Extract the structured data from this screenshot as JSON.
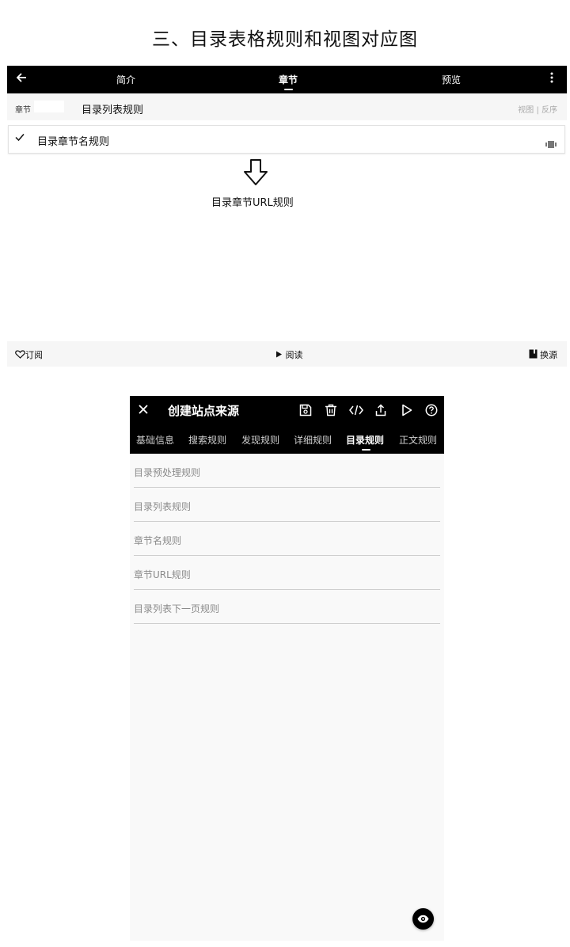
{
  "page_title": "三、目录表格规则和视图对应图",
  "panel1": {
    "toolbar": {
      "tabs": [
        {
          "label": "简介"
        },
        {
          "label": "章节"
        },
        {
          "label": "预览"
        }
      ]
    },
    "section_row": {
      "label": "章节",
      "title": "目录列表规则",
      "right_text": "视图 | 反序"
    },
    "chapter_item": {
      "title": "目录章节名规则"
    },
    "arrow_label": "目录章节URL规则",
    "bottom_bar": {
      "subscribe": "订阅",
      "read": "阅读",
      "switch_source": "换源"
    }
  },
  "panel2": {
    "toolbar": {
      "title": "创建站点来源"
    },
    "tabs": [
      {
        "label": "基础信息"
      },
      {
        "label": "搜索规则"
      },
      {
        "label": "发现规则"
      },
      {
        "label": "详细规则"
      },
      {
        "label": "目录规则"
      },
      {
        "label": "正文规则"
      }
    ],
    "fields": [
      {
        "label": "目录预处理规则"
      },
      {
        "label": "目录列表规则"
      },
      {
        "label": "章节名规则"
      },
      {
        "label": "章节URL规则"
      },
      {
        "label": "目录列表下一页规则"
      }
    ]
  },
  "icons": {
    "panel1": [
      "back-arrow-icon",
      "more-vert-icon",
      "checkmark-icon",
      "scroll-indicator-icon",
      "down-arrow-icon",
      "heart-icon",
      "play-icon",
      "book-icon"
    ],
    "panel2": [
      "close-icon",
      "save-icon",
      "delete-icon",
      "code-icon",
      "share-icon",
      "play-icon",
      "help-icon",
      "eye-icon"
    ]
  }
}
